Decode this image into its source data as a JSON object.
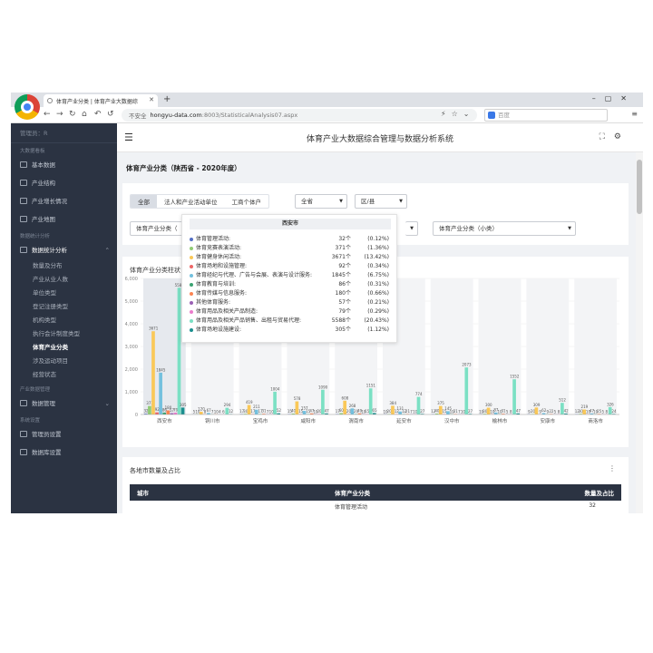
{
  "browser": {
    "tab_title": "体育产业分类 | 体育产业大数据综",
    "address_insecure": "不安全",
    "address_host": "hongyu-data.com",
    "address_path": ":8003/StatisticalAnalysis07.aspx",
    "search_placeholder": "百度"
  },
  "sidebar": {
    "user": "管理员：R",
    "sections": [
      {
        "title": "大数据看板",
        "items": [
          {
            "label": "基本数据"
          },
          {
            "label": "产业结构"
          },
          {
            "label": "产业增长情况"
          },
          {
            "label": "产业地图"
          }
        ]
      },
      {
        "title": "数据统计分析",
        "items": [
          {
            "label": "数据统计分析"
          }
        ]
      }
    ],
    "subitems": [
      "数量及分布",
      "产业从业人数",
      "单位类型",
      "登记注册类型",
      "机构类型",
      "执行会计制度类型",
      "体育产业分类",
      "涉及运动项目",
      "经营状态"
    ],
    "active_sub": "体育产业分类",
    "section3": "产业数据管理",
    "item3": "数据管理",
    "section4": "系统设置",
    "item4a": "管理员设置",
    "item4b": "数据库设置"
  },
  "header": {
    "title": "体育产业大数据综合管理与数据分析系统"
  },
  "page_title": "体育产业分类（陕西省 - 2020年度）",
  "filters": {
    "segments": [
      "全部",
      "法人和产业活动单位",
      "工商个体户"
    ],
    "province": "全省",
    "district": "区/县",
    "cat_large": "体育产业分类（",
    "cat_small": "体育产业分类（小类）"
  },
  "chart": {
    "title": "体育产业分类柱状"
  },
  "chart_data": {
    "type": "bar",
    "categories": [
      "西安市",
      "铜川市",
      "宝鸡市",
      "咸阳市",
      "渭南市",
      "延安市",
      "汉中市",
      "榆林市",
      "安康市",
      "商洛市"
    ],
    "ylim": [
      0,
      6000
    ],
    "yticks": [
      "6,000",
      "5,000",
      "4,000",
      "3,000",
      "2,000",
      "1,000",
      "0"
    ],
    "series": [
      {
        "name": "体育管理活动",
        "color": "#5470c6",
        "values": [
          32,
          5,
          17,
          15,
          17,
          10,
          12,
          10,
          9,
          12
        ]
      },
      {
        "name": "体育竞赛表演活动",
        "color": "#91cc75",
        "values": [
          371,
          10,
          30,
          40,
          60,
          20,
          40,
          30,
          20,
          30
        ]
      },
      {
        "name": "体育健身休闲活动",
        "color": "#fac858",
        "values": [
          3671,
          120,
          419,
          578,
          608,
          384,
          375,
          300,
          309,
          219
        ]
      },
      {
        "name": "体育场地和设施管理",
        "color": "#ee6666",
        "values": [
          92,
          8,
          17,
          15,
          20,
          12,
          15,
          10,
          9,
          10
        ]
      },
      {
        "name": "体育经纪与代理、广告与会展、表演与设计服务",
        "color": "#73c0de",
        "values": [
          1845,
          67,
          211,
          157,
          268,
          131,
          145,
          87,
          62,
          47
        ]
      },
      {
        "name": "体育教育与培训",
        "color": "#3ba272",
        "values": [
          86,
          7,
          17,
          15,
          20,
          12,
          10,
          10,
          9,
          10
        ]
      },
      {
        "name": "体育传媒与信息服务",
        "color": "#fc8452",
        "values": [
          180,
          10,
          31,
          47,
          49,
          21,
          21,
          31,
          22,
          25
        ]
      },
      {
        "name": "其他体育服务",
        "color": "#9a60b4",
        "values": [
          57,
          4,
          7,
          10,
          10,
          7,
          7,
          5,
          5,
          5
        ]
      },
      {
        "name": "体育用品及相关产品制造",
        "color": "#ea7ccc",
        "values": [
          79,
          6,
          10,
          20,
          15,
          10,
          10,
          8,
          8,
          8
        ]
      },
      {
        "name": "体育用品及相关产品销售、出租与贸易代理",
        "color": "#7be0c4",
        "values": [
          5588,
          294,
          1004,
          1090,
          1151,
          774,
          2073,
          1552,
          512,
          326
        ]
      },
      {
        "name": "体育场地设施建设",
        "color": "#1b8f8f",
        "values": [
          305,
          12,
          52,
          47,
          65,
          27,
          27,
          47,
          42,
          24
        ]
      }
    ],
    "tooltip": {
      "title": "西安市",
      "rows": [
        {
          "name": "体育管理活动:",
          "value": "32个",
          "pct": "(0.12%)",
          "color": "#5470c6"
        },
        {
          "name": "体育竞赛表演活动:",
          "value": "371个",
          "pct": "(1.36%)",
          "color": "#91cc75"
        },
        {
          "name": "体育健身休闲活动:",
          "value": "3671个",
          "pct": "(13.42%)",
          "color": "#fac858"
        },
        {
          "name": "体育场地和设施管理:",
          "value": "92个",
          "pct": "(0.34%)",
          "color": "#ee6666"
        },
        {
          "name": "体育经纪与代理、广告与会展、表演与设计服务:",
          "value": "1845个",
          "pct": "(6.75%)",
          "color": "#73c0de"
        },
        {
          "name": "体育教育与培训:",
          "value": "86个",
          "pct": "(0.31%)",
          "color": "#3ba272"
        },
        {
          "name": "体育传媒与信息服务:",
          "value": "180个",
          "pct": "(0.66%)",
          "color": "#fc8452"
        },
        {
          "name": "其他体育服务:",
          "value": "57个",
          "pct": "(0.21%)",
          "color": "#9a60b4"
        },
        {
          "name": "体育用品及相关产品制造:",
          "value": "79个",
          "pct": "(0.29%)",
          "color": "#ea7ccc"
        },
        {
          "name": "体育用品及相关产品销售、出租与贸易代理:",
          "value": "5588个",
          "pct": "(20.43%)",
          "color": "#7be0c4"
        },
        {
          "name": "体育场地设施建设:",
          "value": "305个",
          "pct": "(1.12%)",
          "color": "#1b8f8f"
        }
      ]
    }
  },
  "table": {
    "title": "各地市数量及占比",
    "headers": [
      "城市",
      "体育产业分类",
      "数量及占比"
    ],
    "first_row": {
      "category": "体育管理活动",
      "count": "32"
    }
  }
}
